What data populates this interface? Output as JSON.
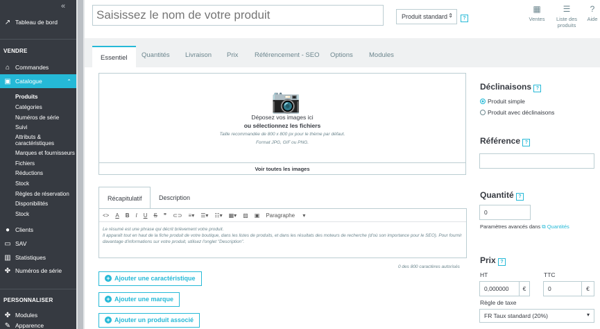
{
  "sidebar": {
    "collapse_glyph": "«",
    "dashboard": "Tableau de bord",
    "section_sell": "VENDRE",
    "orders": "Commandes",
    "catalog": "Catalogue",
    "catalog_sub": [
      "Produits",
      "Catégories",
      "Numéros de série",
      "Suivi",
      "Attributs & caractéristiques",
      "Marques et fournisseurs",
      "Fichiers",
      "Réductions",
      "Stock",
      "Règles de réservation",
      "Disponibilités",
      "Stock"
    ],
    "clients": "Clients",
    "sav": "SAV",
    "stats": "Statistiques",
    "serials": "Numéros de série",
    "section_customize": "PERSONNALISER",
    "modules": "Modules",
    "appearance": "Apparence"
  },
  "header": {
    "product_name_placeholder": "Saisissez le nom de votre produit",
    "product_type": "Produit standard",
    "help": "?",
    "sales": "Ventes",
    "product_list": "Liste des produits",
    "help_label": "Aide"
  },
  "tabs": [
    "Essentiel",
    "Quantités",
    "Livraison",
    "Prix",
    "Référencement - SEO",
    "Options",
    "Modules"
  ],
  "images": {
    "drop_line1": "Déposez vos images ici",
    "drop_line2": "ou sélectionnez les fichiers",
    "recommend": "Taille recommandée de 800 x 800 px pour le thème par défaut.",
    "formats": "Format JPG, GIF ou PNG.",
    "see_all": "Voir toutes les images"
  },
  "desc_tabs": [
    "Récapitulatif",
    "Description"
  ],
  "editor": {
    "paragraph": "Paragraphe",
    "text": "Le résumé est une phrase qui décrit brièvement votre produit.\nIl apparaît tout en haut de la fiche produit de votre boutique, dans les listes de produits, et dans les résultats des moteurs de recherche (d'où son importance pour le SEO). Pour fournir davantage d'informations sur votre produit, utilisez l'onglet \"Description\".",
    "counter": "0 des 800 caractères autorisés"
  },
  "buttons": {
    "add_feature": "Ajouter une caractéristique",
    "add_brand": "Ajouter une marque",
    "add_related": "Ajouter un produit associé"
  },
  "right": {
    "declinations": "Déclinaisons",
    "simple": "Produit simple",
    "with_comb": "Produit avec déclinaisons",
    "reference": "Référence",
    "quantity": "Quantité",
    "quantity_value": "0",
    "advanced": "Paramètres avancés dans",
    "quantities_link": "Quantités",
    "price": "Prix",
    "ht": "HT",
    "ttc": "TTC",
    "ht_value": "0,000000",
    "ttc_value": "0",
    "currency": "€",
    "tax_rule": "Règle de taxe",
    "tax_value": "FR Taux standard (20%)"
  },
  "colors": {
    "accent": "#25b9d7",
    "sidebar": "#363a41"
  }
}
